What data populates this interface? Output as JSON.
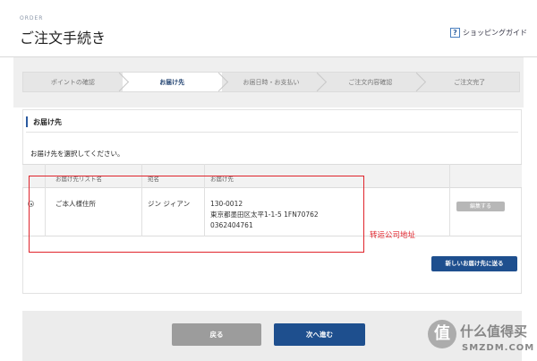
{
  "header": {
    "eyebrow": "ORDER",
    "title": "ご注文手続き",
    "guide_label": "ショッピングガイド",
    "guide_icon_glyph": "?"
  },
  "steps": [
    {
      "label": "ポイントの確認",
      "active": false
    },
    {
      "label": "お届け先",
      "active": true
    },
    {
      "label": "お届日時・お支払い",
      "active": false
    },
    {
      "label": "ご注文内容確認",
      "active": false
    },
    {
      "label": "ご注文完了",
      "active": false
    }
  ],
  "section": {
    "title": "お届け先",
    "instruction": "お届け先を選択してください。"
  },
  "table": {
    "headers": {
      "list_name": "お届け先リスト名",
      "recipient": "宛名",
      "destination": "お届け先"
    },
    "rows": [
      {
        "selected": true,
        "list_name": "ご本人様住所",
        "recipient": "ジン ジィアン",
        "postal": "130-0012",
        "address": "東京都墨田区太平1-1-5 1FN70762",
        "phone": "0362404761",
        "edit_label": "編集する"
      }
    ]
  },
  "annotation": {
    "note": "转运公司地址",
    "color": "#e0242c"
  },
  "buttons": {
    "new_address": "新しいお届け先に送る",
    "back": "戻る",
    "next": "次へ進む"
  },
  "watermark": {
    "glyph": "值",
    "cn": "什么值得买",
    "en": "SMZDM.COM"
  },
  "colors": {
    "primary": "#1e4f8e",
    "secondary_button": "#9c9c9c",
    "annotation_red": "#e0242c"
  }
}
